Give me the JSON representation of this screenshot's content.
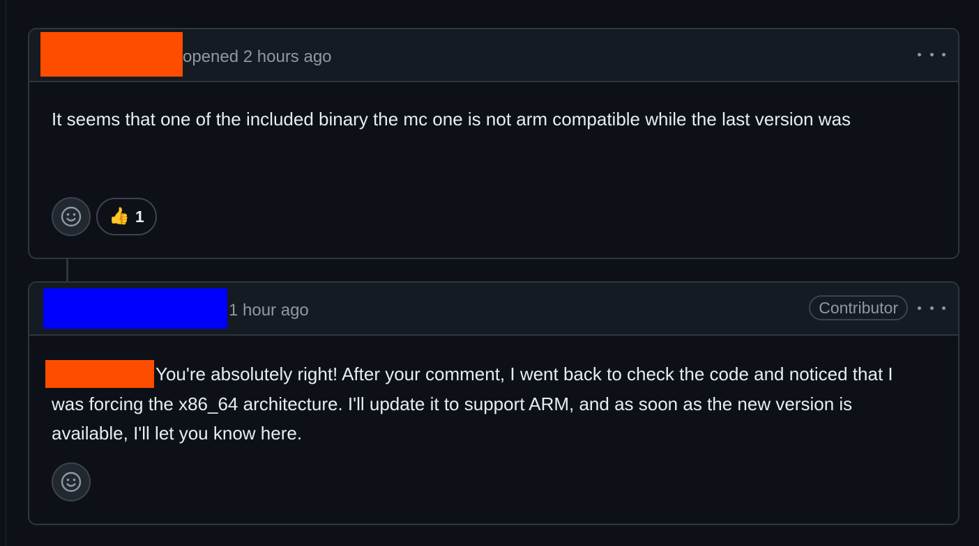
{
  "comment1": {
    "meta": "opened 2 hours ago",
    "body": "It seems that one of the included binary the mc one is not arm compatible while the last version was",
    "reaction": {
      "emoji": "👍",
      "count": "1"
    }
  },
  "comment2": {
    "meta": "1 hour ago",
    "badge": "Contributor",
    "body": "You're absolutely right! After your comment, I went back to check the code and noticed that I was forcing the x86_64 architecture. I'll update it to support ARM, and as soon as the new version is available, I'll let you know here."
  },
  "icons": {
    "menu": "kebab-horizontal-icon",
    "add_reaction": "smiley-icon"
  },
  "colors": {
    "redact_orange": "#ff4d00",
    "redact_blue": "#0000ff",
    "border": "#30363d",
    "muted_text": "#9198a1"
  }
}
